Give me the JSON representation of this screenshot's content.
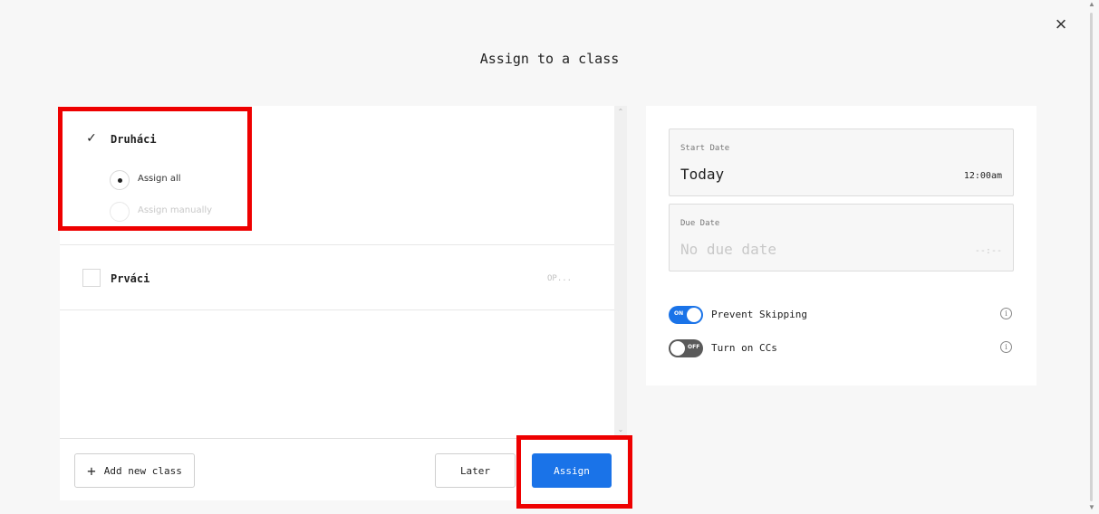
{
  "dialog": {
    "title": "Assign to a class",
    "close_glyph": "×"
  },
  "classes": [
    {
      "name": "Druháci",
      "checked": true,
      "check_glyph": "✓",
      "options": [
        {
          "label": "Assign all",
          "selected": true,
          "disabled": false
        },
        {
          "label": "Assign manually",
          "selected": false,
          "disabled": true
        }
      ]
    },
    {
      "name": "Prváci",
      "checked": false,
      "extra": "OP..."
    }
  ],
  "footer": {
    "add_label": "Add new class",
    "add_icon": "+",
    "later_label": "Later",
    "assign_label": "Assign"
  },
  "schedule": {
    "start": {
      "label": "Start Date",
      "value": "Today",
      "time": "12:00am"
    },
    "due": {
      "label": "Due Date",
      "placeholder": "No due date",
      "time_placeholder": "--:--"
    }
  },
  "toggles": [
    {
      "label": "Prevent Skipping",
      "state": "ON",
      "on": true,
      "info_icon": "info-icon"
    },
    {
      "label": "Turn on CCs",
      "state": "OFF",
      "on": false,
      "info_icon": "info-icon"
    }
  ],
  "colors": {
    "accent": "#1a73e8",
    "highlight": "#ee0000",
    "toggle_off": "#5a5a5a"
  }
}
